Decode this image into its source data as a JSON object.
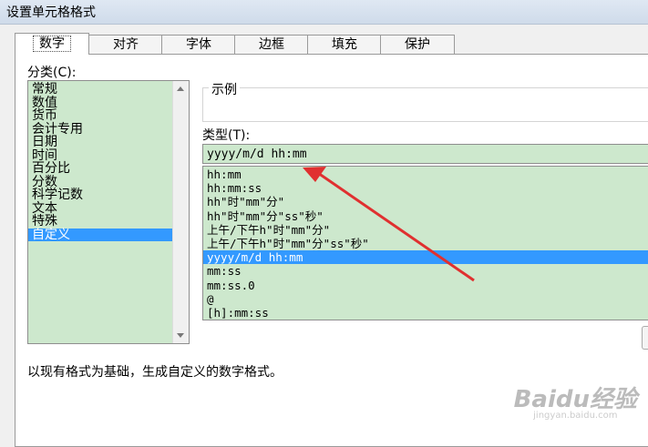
{
  "dialog": {
    "title": "设置单元格格式"
  },
  "tabs": [
    {
      "label": "数字",
      "active": true
    },
    {
      "label": "对齐"
    },
    {
      "label": "字体"
    },
    {
      "label": "边框"
    },
    {
      "label": "填充"
    },
    {
      "label": "保护"
    }
  ],
  "category": {
    "label": "分类(C):",
    "items": [
      "常规",
      "数值",
      "货币",
      "会计专用",
      "日期",
      "时间",
      "百分比",
      "分数",
      "科学记数",
      "文本",
      "特殊",
      "自定义"
    ],
    "selected": "自定义"
  },
  "sample": {
    "legend": "示例"
  },
  "type": {
    "label": "类型(T):",
    "value": "yyyy/m/d hh:mm",
    "formats": [
      "hh:mm",
      "hh:mm:ss",
      "hh\"时\"mm\"分\"",
      "hh\"时\"mm\"分\"ss\"秒\"",
      "上午/下午h\"时\"mm\"分\"",
      "上午/下午h\"时\"mm\"分\"ss\"秒\"",
      "yyyy/m/d hh:mm",
      "mm:ss",
      "mm:ss.0",
      "@",
      "[h]:mm:ss"
    ],
    "selected": "yyyy/m/d hh:mm"
  },
  "description": "以现有格式为基础，生成自定义的数字格式。",
  "watermark": {
    "brand": "Baidu经验",
    "url": "jingyan.baidu.com"
  },
  "colors": {
    "list_bg": "#cde8cd",
    "selection": "#3399ff",
    "annotation_arrow": "#e03030"
  }
}
